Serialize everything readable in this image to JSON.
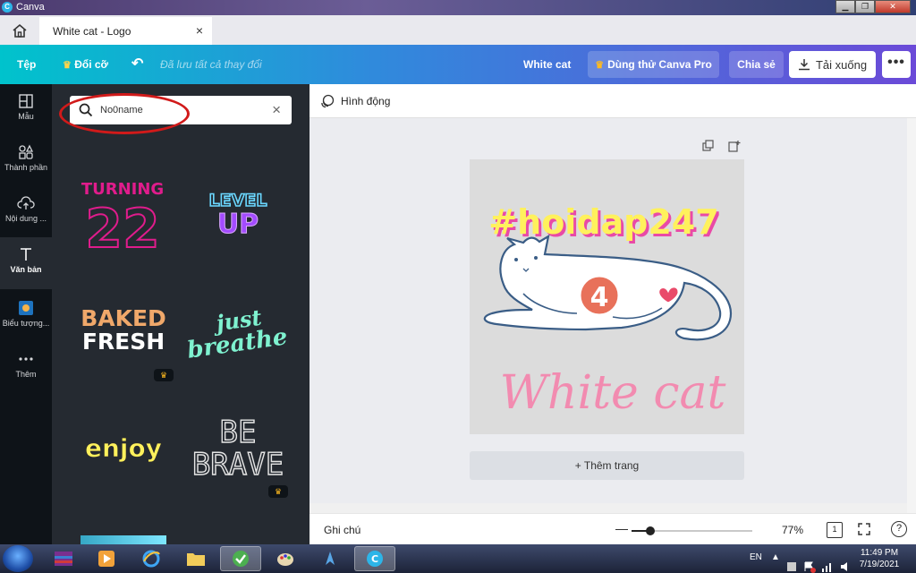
{
  "window": {
    "title": "Canva",
    "controls": {
      "minimize": "▁",
      "maximize": "❐",
      "close": "✕"
    }
  },
  "tabs": [
    {
      "label": "White cat - Logo",
      "close": "×"
    }
  ],
  "toolbar": {
    "file": "Tệp",
    "resize": "Đổi cỡ",
    "saved_status": "Đã lưu tất cả thay đổi",
    "project_name": "White cat",
    "try_pro": "Dùng thử Canva Pro",
    "share": "Chia sẻ",
    "download": "Tải xuống",
    "more": "•••"
  },
  "rail": [
    {
      "label": "Mẫu",
      "icon": "template-icon"
    },
    {
      "label": "Thành phần",
      "icon": "elements-icon"
    },
    {
      "label": "Nội dung ...",
      "icon": "upload-icon"
    },
    {
      "label": "Văn bản",
      "icon": "text-icon",
      "active": true
    },
    {
      "label": "Biểu tượng...",
      "icon": "logo-icon"
    },
    {
      "label": "Thêm",
      "icon": "more-icon"
    }
  ],
  "search": {
    "value": "No0name"
  },
  "text_tiles": [
    {
      "line1": "TURNING",
      "line2": "22"
    },
    {
      "line1": "LEVEL",
      "line2": "UP"
    },
    {
      "line1": "BAKED",
      "line2": "FRESH",
      "pro": true
    },
    {
      "line1": "just",
      "line2": "breathe"
    },
    {
      "line1": "enjoy"
    },
    {
      "line1": "BE",
      "line2": "BRAVE",
      "pro": true
    }
  ],
  "crown": "♛",
  "canvas_toolbar": {
    "animate": "Hình động"
  },
  "design": {
    "hashtag": "#hoidap247",
    "badge_number": "4",
    "brand": "White cat",
    "colors": {
      "background": "#dcdcdc",
      "hashtag": "#fff15c",
      "hashtag_shadow": "#e94aa6",
      "brand": "#f28bb0",
      "badge": "#e8715a",
      "outline": "#3a5d86"
    }
  },
  "add_page": "+ Thêm trang",
  "bottom": {
    "notes": "Ghi chú",
    "zoom_percent": 77,
    "zoom_label": "77%",
    "page_count": "1",
    "help": "?"
  },
  "taskbar": {
    "language": "EN",
    "time": "11:49 PM",
    "date": "7/19/2021",
    "apps": [
      "winrar-icon",
      "media-player-icon",
      "ie-icon",
      "explorer-icon",
      "app-green-icon",
      "paint-icon",
      "network-icon",
      "canva-icon"
    ]
  }
}
